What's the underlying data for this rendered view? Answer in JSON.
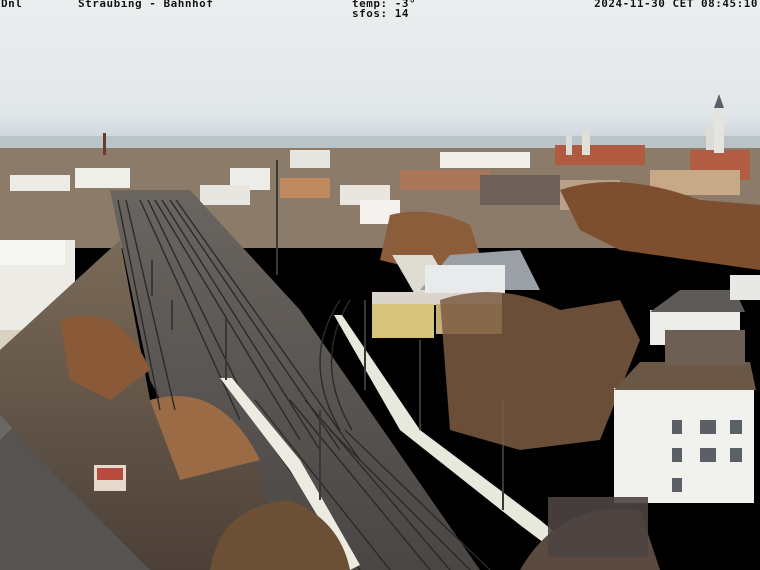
{
  "overlay": {
    "camera_id": "Dnl",
    "title": "Straubing - Bahnhof",
    "temp": "temp: -3°",
    "sfos": "sfos: 14",
    "timestamp": "2024-11-30 CET 08:45:10"
  },
  "colors": {
    "sky_top": "#e9ecec",
    "sky_horizon": "#dde3e6",
    "haze": "#c9d2d8",
    "trees_autumn": "#8a5a34",
    "track_gravel": "#5a5550",
    "rail": "#2e2c2a",
    "wall": "#e8e6dc",
    "roof": "#6b5a4c",
    "white_building": "#f2f2ee"
  },
  "scene": {
    "subject": "webcam view over railway station yard",
    "icons": [
      "catenary-mast-icon",
      "church-tower-icon",
      "chimney-icon"
    ]
  }
}
